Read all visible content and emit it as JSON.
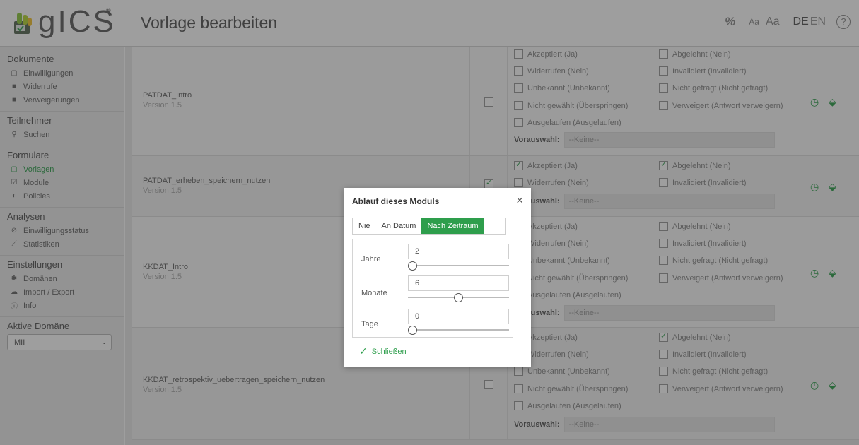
{
  "app": {
    "logo_text": "gICS",
    "logo_reg": "®",
    "page_title": "Vorlage bearbeiten",
    "header_tools": {
      "percent_icon": "%",
      "font_small": "Aa",
      "font_large": "Aa",
      "lang_de": "DE",
      "lang_en": "EN",
      "help": "?"
    }
  },
  "sidebar": {
    "sections": [
      {
        "title": "Dokumente",
        "items": [
          {
            "label": "Einwilligungen",
            "icon": "document-icon"
          },
          {
            "label": "Widerrufe",
            "icon": "document-filled-icon"
          },
          {
            "label": "Verweigerungen",
            "icon": "document-filled-icon"
          }
        ]
      },
      {
        "title": "Teilnehmer",
        "items": [
          {
            "label": "Suchen",
            "icon": "users-icon"
          }
        ]
      },
      {
        "title": "Formulare",
        "items": [
          {
            "label": "Vorlagen",
            "icon": "document-icon"
          },
          {
            "label": "Module",
            "icon": "checkbox-icon"
          },
          {
            "label": "Policies",
            "icon": "shield-icon"
          }
        ]
      },
      {
        "title": "Analysen",
        "items": [
          {
            "label": "Einwilligungsstatus",
            "icon": "check-circle-icon"
          },
          {
            "label": "Statistiken",
            "icon": "chart-icon"
          }
        ]
      },
      {
        "title": "Einstellungen",
        "items": [
          {
            "label": "Domänen",
            "icon": "gear-icon"
          },
          {
            "label": "Import / Export",
            "icon": "cloud-icon"
          },
          {
            "label": "Info",
            "icon": "info-icon"
          }
        ]
      }
    ],
    "domain": {
      "title": "Aktive Domäne",
      "selected": "MII"
    }
  },
  "modules": [
    {
      "name": "PATDAT_Intro",
      "version": "Version 1.5",
      "selected": false,
      "statuses": [
        {
          "label": "Akzeptiert (Ja)",
          "checked": false
        },
        {
          "label": "Abgelehnt (Nein)",
          "checked": false
        },
        {
          "label": "Widerrufen (Nein)",
          "checked": false
        },
        {
          "label": "Invalidiert (Invalidiert)",
          "checked": false
        },
        {
          "label": "Unbekannt (Unbekannt)",
          "checked": false
        },
        {
          "label": "Nicht gefragt (Nicht gefragt)",
          "checked": false
        },
        {
          "label": "Nicht gewählt (Überspringen)",
          "checked": false
        },
        {
          "label": "Verweigert (Antwort verweigern)",
          "checked": false
        },
        {
          "label": "Ausgelaufen (Ausgelaufen)",
          "checked": false
        }
      ],
      "vorauswahl_label": "Vorauswahl:",
      "vorauswahl_value": "--Keine--"
    },
    {
      "name": "PATDAT_erheben_speichern_nutzen",
      "version": "Version 1.5",
      "selected": true,
      "statuses": [
        {
          "label": "Akzeptiert (Ja)",
          "checked": true
        },
        {
          "label": "Abgelehnt (Nein)",
          "checked": true
        },
        {
          "label": "Widerrufen (Nein)",
          "checked": false
        },
        {
          "label": "Invalidiert (Invalidiert)",
          "checked": false
        }
      ],
      "vorauswahl_label": "Vorauswahl:",
      "vorauswahl_value": "--Keine--"
    },
    {
      "name": "KKDAT_Intro",
      "version": "Version 1.5",
      "selected": false,
      "statuses": [
        {
          "label": "Akzeptiert (Ja)",
          "checked": false
        },
        {
          "label": "Abgelehnt (Nein)",
          "checked": false
        },
        {
          "label": "Widerrufen (Nein)",
          "checked": false
        },
        {
          "label": "Invalidiert (Invalidiert)",
          "checked": false
        },
        {
          "label": "Unbekannt (Unbekannt)",
          "checked": false
        },
        {
          "label": "Nicht gefragt (Nicht gefragt)",
          "checked": false
        },
        {
          "label": "Nicht gewählt (Überspringen)",
          "checked": false
        },
        {
          "label": "Verweigert (Antwort verweigern)",
          "checked": false
        },
        {
          "label": "Ausgelaufen (Ausgelaufen)",
          "checked": false
        }
      ],
      "vorauswahl_label": "Vorauswahl:",
      "vorauswahl_value": "--Keine--"
    },
    {
      "name": "KKDAT_retrospektiv_uebertragen_speichern_nutzen",
      "version": "Version 1.5",
      "selected": false,
      "statuses": [
        {
          "label": "Akzeptiert (Ja)",
          "checked": false
        },
        {
          "label": "Abgelehnt (Nein)",
          "checked": true
        },
        {
          "label": "Widerrufen (Nein)",
          "checked": false
        },
        {
          "label": "Invalidiert (Invalidiert)",
          "checked": false
        },
        {
          "label": "Unbekannt (Unbekannt)",
          "checked": false
        },
        {
          "label": "Nicht gefragt (Nicht gefragt)",
          "checked": false
        },
        {
          "label": "Nicht gewählt (Überspringen)",
          "checked": false
        },
        {
          "label": "Verweigert (Antwort verweigern)",
          "checked": false
        },
        {
          "label": "Ausgelaufen (Ausgelaufen)",
          "checked": false
        }
      ],
      "vorauswahl_label": "Vorauswahl:",
      "vorauswahl_value": "--Keine--"
    }
  ],
  "modal": {
    "title": "Ablauf dieses Moduls",
    "close": "×",
    "tabs": [
      "Nie",
      "An Datum",
      "Nach Zeitraum"
    ],
    "active_tab": "Nach Zeitraum",
    "fields": [
      {
        "label": "Jahre",
        "value": "2",
        "slider_fraction": 0.0
      },
      {
        "label": "Monate",
        "value": "6",
        "slider_fraction": 0.5
      },
      {
        "label": "Tage",
        "value": "0",
        "slider_fraction": 0.0
      }
    ],
    "close_button": "Schließen"
  },
  "colors": {
    "accent": "#2e9e4c"
  }
}
